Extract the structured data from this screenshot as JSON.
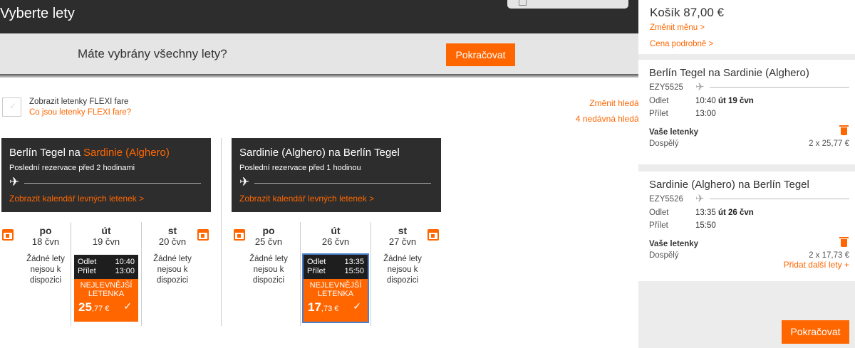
{
  "header": {
    "title": "Vyberte lety"
  },
  "all_selected": {
    "question": "Máte vybrány všechny lety?",
    "continue_label": "Pokračovat"
  },
  "options": {
    "flexi_label": "Zobrazit letenky FLEXI fare",
    "flexi_link": "Co jsou letenky FLEXI fare?",
    "change_search": "Změnit hledání >",
    "recent_searches": "4 nedávná hledání >"
  },
  "outbound": {
    "title_prefix": "Berlín Tegel na ",
    "title_dest": "Sardinie (Alghero)",
    "last_booking": "Poslední rezervace před 2 hodinami",
    "calendar_link": "Zobrazit kalendář levných letenek >",
    "days": [
      {
        "name": "po",
        "date": "18 čvn",
        "no_flights": "Žádné lety nejsou k dispozici"
      },
      {
        "name": "út",
        "date": "19 čvn"
      },
      {
        "name": "st",
        "date": "20 čvn",
        "no_flights": "Žádné lety nejsou k dispozici"
      }
    ],
    "flight": {
      "depart_label": "Odlet",
      "depart_time": "10:40",
      "arrive_label": "Přílet",
      "arrive_time": "13:00",
      "badge": "NEJLEVNĚJŠÍ LETENKA",
      "price_int": "25",
      "price_dec": ",77 €"
    }
  },
  "return": {
    "title": "Sardinie (Alghero) na Berlín Tegel",
    "last_booking": "Poslední rezervace před 1 hodinou",
    "calendar_link": "Zobrazit kalendář levných letenek >",
    "days": [
      {
        "name": "po",
        "date": "25 čvn",
        "no_flights": "Žádné lety nejsou k dispozici"
      },
      {
        "name": "út",
        "date": "26 čvn"
      },
      {
        "name": "st",
        "date": "27 čvn",
        "no_flights": "Žádné lety nejsou k dispozici"
      }
    ],
    "flight": {
      "depart_label": "Odlet",
      "depart_time": "13:35",
      "arrive_label": "Přílet",
      "arrive_time": "15:50",
      "badge": "NEJLEVNĚJŠÍ LETENKA",
      "price_int": "17",
      "price_dec": ",73 €"
    }
  },
  "basket": {
    "title": "Košík 87,00 €",
    "change_currency": "Změnit měnu >",
    "price_detail": "Cena podrobně >",
    "continue_label": "Pokračovat",
    "add_more": "Přidat další lety +",
    "segments": [
      {
        "title": "Berlín Tegel na Sardinie (Alghero)",
        "flight_no": "EZY5525",
        "depart_label": "Odlet",
        "depart_time": "10:40",
        "depart_date": "út 19 čvn",
        "arrive_label": "Přílet",
        "arrive_time": "13:00",
        "tickets_label": "Vaše letenky",
        "pax_label": "Dospělý",
        "pax_price": "2 x 25,77 €"
      },
      {
        "title": "Sardinie (Alghero) na Berlín Tegel",
        "flight_no": "EZY5526",
        "depart_label": "Odlet",
        "depart_time": "13:35",
        "depart_date": "út 26 čvn",
        "arrive_label": "Přílet",
        "arrive_time": "15:50",
        "tickets_label": "Vaše letenky",
        "pax_label": "Dospělý",
        "pax_price": "2 x 17,73 €"
      }
    ]
  },
  "colors": {
    "accent": "#ff6600",
    "dark": "#2d2d2d",
    "selected_outline": "#4a7fcf"
  },
  "icons": [
    "plane-icon",
    "calendar-icon",
    "check-icon",
    "trash-icon",
    "checkbox-icon"
  ]
}
